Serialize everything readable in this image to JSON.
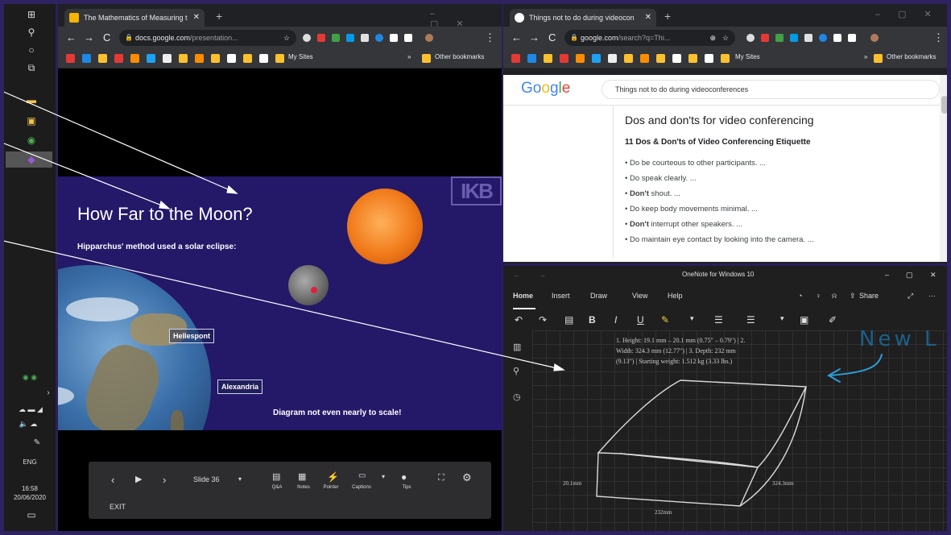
{
  "taskbar": {
    "time": "16:58",
    "date": "20/06/2020",
    "lang": "ENG"
  },
  "left_browser": {
    "tab_title": "The Mathematics of Measuring t",
    "url_domain": "docs.google.com",
    "url_path": "/presentation...",
    "bookmarks": {
      "my_sites": "My Sites",
      "other": "Other bookmarks"
    }
  },
  "slide": {
    "title": "How Far to the Moon?",
    "subtitle": "Hipparchus' method used a solar eclipse:",
    "label_hellespont": "Hellespont",
    "label_alexandria": "Alexandria",
    "note": "Diagram not even nearly to scale!",
    "logo": "IKB"
  },
  "presenter": {
    "slide_label": "Slide 36",
    "qa": "Q&A",
    "notes": "Notes",
    "pointer": "Pointer",
    "captions": "Captions",
    "tips": "Tips",
    "exit": "EXIT"
  },
  "right_browser": {
    "tab_title": "Things not to do during videocon",
    "url_domain": "google.com",
    "url_path": "/search?q=Thi...",
    "bookmarks": {
      "my_sites": "My Sites",
      "other": "Other bookmarks"
    },
    "search_query": "Things not to do during videoconferences",
    "logo": "Google"
  },
  "results": {
    "heading": "Dos and don'ts for video conferencing",
    "subheading": "11 Dos & Don'ts of Video Conferencing Etiquette",
    "items": [
      {
        "bold": "",
        "text": "Do be courteous to other participants. ..."
      },
      {
        "bold": "",
        "text": "Do speak clearly. ..."
      },
      {
        "bold": "Don't",
        "text": " shout. ..."
      },
      {
        "bold": "",
        "text": "Do keep body movements minimal. ..."
      },
      {
        "bold": "Don't",
        "text": " interrupt other speakers. ..."
      },
      {
        "bold": "",
        "text": "Do maintain eye contact by looking into the camera. ..."
      }
    ]
  },
  "onenote": {
    "title": "OneNote for Windows 10",
    "menu": [
      "Home",
      "Insert",
      "Draw",
      "View",
      "Help"
    ],
    "share": "Share",
    "note_lines": [
      "1. Height: 19.1 mm – 20.1 mm (0.75\" – 0.79\") | 2.",
      "Width: 324.3 mm (12.77\") | 3. Depth: 232 mm",
      "(9.13\") | Starting weight: 1.512 kg (3.33 lbs.)"
    ],
    "dim_height": "20.1mm",
    "dim_width": "324.3mm",
    "dim_depth": "232mm",
    "handwriting": "New L"
  }
}
